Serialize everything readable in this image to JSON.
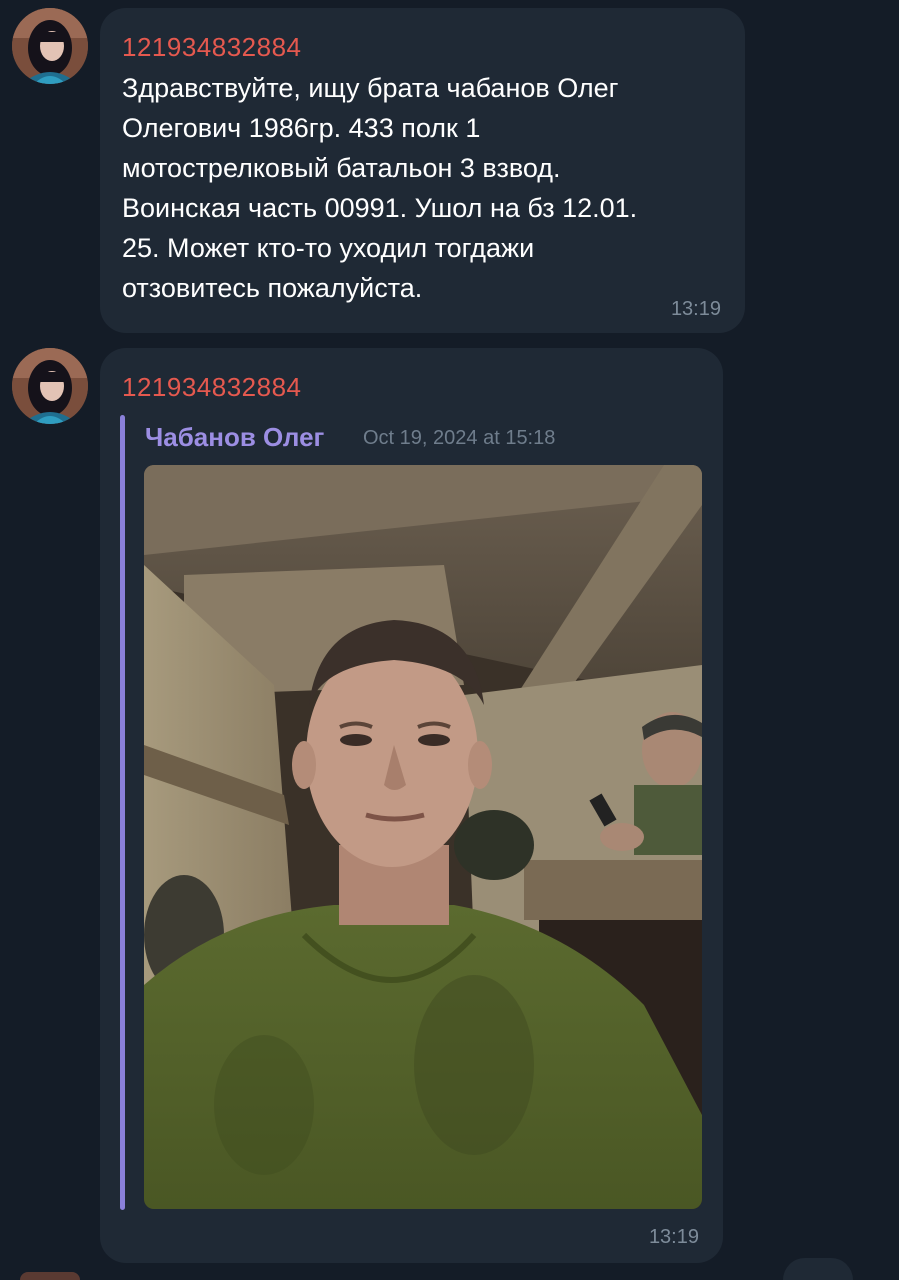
{
  "messages": [
    {
      "sender": "121934832884",
      "text": "Здравствуйте, ищу брата чабанов Олег\nОлегович 1986гр. 433 полк 1\nмотострелковый батальон 3 взвод.\nВоинская часть 00991. Ушол на бз 12.01.\n25. Может кто-то уходил тогдажи\nотзовитесь пожалуйста.",
      "time": "13:19"
    },
    {
      "sender": "121934832884",
      "forwarded_from": "Чабанов Олег",
      "forwarded_date": "Oct 19, 2024 at 15:18",
      "time": "13:19"
    }
  ],
  "colors": {
    "background": "#141c27",
    "bubble": "#1f2935",
    "sender_name": "#e5594f",
    "forward_accent": "#8a80d9",
    "timestamp": "#7d8b99"
  },
  "icons": [
    "user-avatar",
    "forwarded-photo"
  ]
}
